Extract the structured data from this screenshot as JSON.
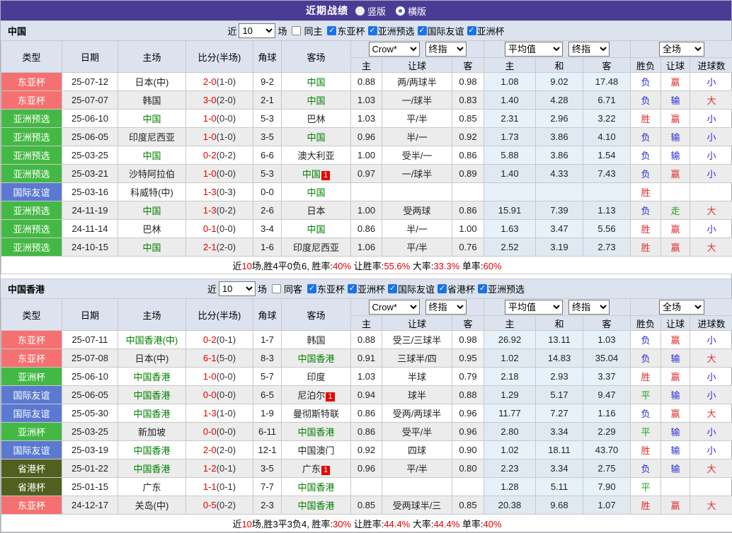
{
  "top_bar": {
    "title": "近期战绩",
    "radios": [
      {
        "label": "竖版",
        "selected": false
      },
      {
        "label": "横版",
        "selected": true
      }
    ]
  },
  "table_header": {
    "main_columns": [
      "类型",
      "日期",
      "主场",
      "比分(半场)",
      "角球",
      "客场"
    ],
    "dropdowns": {
      "crow": "Crow*",
      "final_a": "终指",
      "avg": "平均值",
      "final_b": "终指",
      "full": "全场"
    },
    "sub_columns": [
      "主",
      "让球",
      "客",
      "主",
      "和",
      "客",
      "胜负",
      "让球",
      "进球数"
    ]
  },
  "colors": {
    "topbar": "#4a3c94",
    "type_badges": {
      "东亚杯": "#f57070",
      "亚洲预选": "#44b844",
      "亚洲杯": "#44b844",
      "国际友谊": "#5b79d0",
      "省港杯": "#52601f"
    },
    "team_green": "#008000",
    "score_red": "#dd0000",
    "result_red": "#e03030",
    "result_blue": "#2b2bd5",
    "result_green": "#1f9e1f"
  },
  "sections": [
    {
      "team": "中国",
      "filters": {
        "near": "近",
        "count": "10",
        "games": "场",
        "same": "同主",
        "same_checked": false,
        "leagues": [
          "东亚杯",
          "亚洲预选",
          "国际友谊",
          "亚洲杯"
        ]
      },
      "rows": [
        {
          "type": "东亚杯",
          "date": "25-07-12",
          "home": "日本(中)",
          "home_green": false,
          "home_badge": "",
          "score": "2-0",
          "half": "(1-0)",
          "corner": "9-2",
          "away": "中国",
          "away_green": true,
          "away_badge": "",
          "odds": [
            "0.88",
            "两/两球半",
            "0.98"
          ],
          "avg": [
            "1.08",
            "9.02",
            "17.48"
          ],
          "res": [
            [
              "负",
              "b"
            ],
            [
              "赢",
              "r"
            ],
            [
              "小",
              "b"
            ]
          ]
        },
        {
          "type": "东亚杯",
          "date": "25-07-07",
          "home": "韩国",
          "home_green": false,
          "home_badge": "",
          "score": "3-0",
          "half": "(2-0)",
          "corner": "2-1",
          "away": "中国",
          "away_green": true,
          "away_badge": "",
          "odds": [
            "1.03",
            "一/球半",
            "0.83"
          ],
          "avg": [
            "1.40",
            "4.28",
            "6.71"
          ],
          "res": [
            [
              "负",
              "b"
            ],
            [
              "输",
              "b"
            ],
            [
              "大",
              "r"
            ]
          ]
        },
        {
          "type": "亚洲预选",
          "date": "25-06-10",
          "home": "中国",
          "home_green": true,
          "home_badge": "",
          "score": "1-0",
          "half": "(0-0)",
          "corner": "5-3",
          "away": "巴林",
          "away_green": false,
          "away_badge": "",
          "odds": [
            "1.03",
            "平/半",
            "0.85"
          ],
          "avg": [
            "2.31",
            "2.96",
            "3.22"
          ],
          "res": [
            [
              "胜",
              "r"
            ],
            [
              "赢",
              "r"
            ],
            [
              "小",
              "b"
            ]
          ]
        },
        {
          "type": "亚洲预选",
          "date": "25-06-05",
          "home": "印度尼西亚",
          "home_green": false,
          "home_badge": "",
          "score": "1-0",
          "half": "(1-0)",
          "corner": "3-5",
          "away": "中国",
          "away_green": true,
          "away_badge": "",
          "odds": [
            "0.96",
            "半/一",
            "0.92"
          ],
          "avg": [
            "1.73",
            "3.86",
            "4.10"
          ],
          "res": [
            [
              "负",
              "b"
            ],
            [
              "输",
              "b"
            ],
            [
              "小",
              "b"
            ]
          ]
        },
        {
          "type": "亚洲预选",
          "date": "25-03-25",
          "home": "中国",
          "home_green": true,
          "home_badge": "",
          "score": "0-2",
          "half": "(0-2)",
          "corner": "6-6",
          "away": "澳大利亚",
          "away_green": false,
          "away_badge": "",
          "odds": [
            "1.00",
            "受半/一",
            "0.86"
          ],
          "avg": [
            "5.88",
            "3.86",
            "1.54"
          ],
          "res": [
            [
              "负",
              "b"
            ],
            [
              "输",
              "b"
            ],
            [
              "小",
              "b"
            ]
          ]
        },
        {
          "type": "亚洲预选",
          "date": "25-03-21",
          "home": "沙特阿拉伯",
          "home_green": false,
          "home_badge": "",
          "score": "1-0",
          "half": "(0-0)",
          "corner": "5-3",
          "away": "中国",
          "away_green": true,
          "away_badge": "1",
          "odds": [
            "0.97",
            "一/球半",
            "0.89"
          ],
          "avg": [
            "1.40",
            "4.33",
            "7.43"
          ],
          "res": [
            [
              "负",
              "b"
            ],
            [
              "赢",
              "r"
            ],
            [
              "小",
              "b"
            ]
          ]
        },
        {
          "type": "国际友谊",
          "date": "25-03-16",
          "home": "科威特(中)",
          "home_green": false,
          "home_badge": "",
          "score": "1-3",
          "half": "(0-3)",
          "corner": "0-0",
          "away": "中国",
          "away_green": true,
          "away_badge": "",
          "odds": [
            "",
            "",
            ""
          ],
          "avg": [
            "",
            "",
            ""
          ],
          "res": [
            [
              "胜",
              "r"
            ],
            [
              "",
              ""
            ],
            [
              "",
              ""
            ]
          ]
        },
        {
          "type": "亚洲预选",
          "date": "24-11-19",
          "home": "中国",
          "home_green": true,
          "home_badge": "",
          "score": "1-3",
          "half": "(0-2)",
          "corner": "2-6",
          "away": "日本",
          "away_green": false,
          "away_badge": "",
          "odds": [
            "1.00",
            "受两球",
            "0.86"
          ],
          "avg": [
            "15.91",
            "7.39",
            "1.13"
          ],
          "res": [
            [
              "负",
              "b"
            ],
            [
              "走",
              "g"
            ],
            [
              "大",
              "r"
            ]
          ]
        },
        {
          "type": "亚洲预选",
          "date": "24-11-14",
          "home": "巴林",
          "home_green": false,
          "home_badge": "",
          "score": "0-1",
          "half": "(0-0)",
          "corner": "3-4",
          "away": "中国",
          "away_green": true,
          "away_badge": "",
          "odds": [
            "0.86",
            "半/一",
            "1.00"
          ],
          "avg": [
            "1.63",
            "3.47",
            "5.56"
          ],
          "res": [
            [
              "胜",
              "r"
            ],
            [
              "赢",
              "r"
            ],
            [
              "小",
              "b"
            ]
          ]
        },
        {
          "type": "亚洲预选",
          "date": "24-10-15",
          "home": "中国",
          "home_green": true,
          "home_badge": "",
          "score": "2-1",
          "half": "(2-0)",
          "corner": "1-6",
          "away": "印度尼西亚",
          "away_green": false,
          "away_badge": "",
          "odds": [
            "1.06",
            "平/半",
            "0.76"
          ],
          "avg": [
            "2.52",
            "3.19",
            "2.73"
          ],
          "res": [
            [
              "胜",
              "r"
            ],
            [
              "赢",
              "r"
            ],
            [
              "大",
              "r"
            ]
          ]
        }
      ],
      "summary": [
        [
          "近",
          0
        ],
        [
          "10",
          1
        ],
        [
          "场,胜4平0负6, 胜率:",
          0
        ],
        [
          "40%",
          1
        ],
        [
          " 让胜率:",
          0
        ],
        [
          "55.6%",
          1
        ],
        [
          " 大率:",
          0
        ],
        [
          "33.3%",
          1
        ],
        [
          " 单率:",
          0
        ],
        [
          "60%",
          1
        ]
      ]
    },
    {
      "team": "中国香港",
      "filters": {
        "near": "近",
        "count": "10",
        "games": "场",
        "same": "同客",
        "same_checked": false,
        "leagues": [
          "东亚杯",
          "亚洲杯",
          "国际友谊",
          "省港杯",
          "亚洲预选"
        ]
      },
      "rows": [
        {
          "type": "东亚杯",
          "date": "25-07-11",
          "home": "中国香港(中)",
          "home_green": true,
          "home_badge": "",
          "score": "0-2",
          "half": "(0-1)",
          "corner": "1-7",
          "away": "韩国",
          "away_green": false,
          "away_badge": "",
          "odds": [
            "0.88",
            "受三/三球半",
            "0.98"
          ],
          "avg": [
            "26.92",
            "13.11",
            "1.03"
          ],
          "res": [
            [
              "负",
              "b"
            ],
            [
              "赢",
              "r"
            ],
            [
              "小",
              "b"
            ]
          ]
        },
        {
          "type": "东亚杯",
          "date": "25-07-08",
          "home": "日本(中)",
          "home_green": false,
          "home_badge": "",
          "score": "6-1",
          "half": "(5-0)",
          "corner": "8-3",
          "away": "中国香港",
          "away_green": true,
          "away_badge": "",
          "odds": [
            "0.91",
            "三球半/四",
            "0.95"
          ],
          "avg": [
            "1.02",
            "14.83",
            "35.04"
          ],
          "res": [
            [
              "负",
              "b"
            ],
            [
              "输",
              "b"
            ],
            [
              "大",
              "r"
            ]
          ]
        },
        {
          "type": "亚洲杯",
          "date": "25-06-10",
          "home": "中国香港",
          "home_green": true,
          "home_badge": "",
          "score": "1-0",
          "half": "(0-0)",
          "corner": "5-7",
          "away": "印度",
          "away_green": false,
          "away_badge": "",
          "odds": [
            "1.03",
            "半球",
            "0.79"
          ],
          "avg": [
            "2.18",
            "2.93",
            "3.37"
          ],
          "res": [
            [
              "胜",
              "r"
            ],
            [
              "赢",
              "r"
            ],
            [
              "小",
              "b"
            ]
          ]
        },
        {
          "type": "国际友谊",
          "date": "25-06-05",
          "home": "中国香港",
          "home_green": true,
          "home_badge": "",
          "score": "0-0",
          "half": "(0-0)",
          "corner": "6-5",
          "away": "尼泊尔",
          "away_green": false,
          "away_badge": "1",
          "odds": [
            "0.94",
            "球半",
            "0.88"
          ],
          "avg": [
            "1.29",
            "5.17",
            "9.47"
          ],
          "res": [
            [
              "平",
              "g"
            ],
            [
              "输",
              "b"
            ],
            [
              "小",
              "b"
            ]
          ]
        },
        {
          "type": "国际友谊",
          "date": "25-05-30",
          "home": "中国香港",
          "home_green": true,
          "home_badge": "",
          "score": "1-3",
          "half": "(1-0)",
          "corner": "1-9",
          "away": "曼彻斯特联",
          "away_green": false,
          "away_badge": "",
          "odds": [
            "0.86",
            "受两/两球半",
            "0.96"
          ],
          "avg": [
            "11.77",
            "7.27",
            "1.16"
          ],
          "res": [
            [
              "负",
              "b"
            ],
            [
              "赢",
              "r"
            ],
            [
              "大",
              "r"
            ]
          ]
        },
        {
          "type": "亚洲杯",
          "date": "25-03-25",
          "home": "新加坡",
          "home_green": false,
          "home_badge": "",
          "score": "0-0",
          "half": "(0-0)",
          "corner": "6-11",
          "away": "中国香港",
          "away_green": true,
          "away_badge": "",
          "odds": [
            "0.86",
            "受平/半",
            "0.96"
          ],
          "avg": [
            "2.80",
            "3.34",
            "2.29"
          ],
          "res": [
            [
              "平",
              "g"
            ],
            [
              "输",
              "b"
            ],
            [
              "小",
              "b"
            ]
          ]
        },
        {
          "type": "国际友谊",
          "date": "25-03-19",
          "home": "中国香港",
          "home_green": true,
          "home_badge": "",
          "score": "2-0",
          "half": "(2-0)",
          "corner": "12-1",
          "away": "中国澳门",
          "away_green": false,
          "away_badge": "",
          "odds": [
            "0.92",
            "四球",
            "0.90"
          ],
          "avg": [
            "1.02",
            "18.11",
            "43.70"
          ],
          "res": [
            [
              "胜",
              "r"
            ],
            [
              "输",
              "b"
            ],
            [
              "小",
              "b"
            ]
          ]
        },
        {
          "type": "省港杯",
          "date": "25-01-22",
          "home": "中国香港",
          "home_green": true,
          "home_badge": "",
          "score": "1-2",
          "half": "(0-1)",
          "corner": "3-5",
          "away": "广东",
          "away_green": false,
          "away_badge": "1",
          "odds": [
            "0.96",
            "平/半",
            "0.80"
          ],
          "avg": [
            "2.23",
            "3.34",
            "2.75"
          ],
          "res": [
            [
              "负",
              "b"
            ],
            [
              "输",
              "b"
            ],
            [
              "大",
              "r"
            ]
          ]
        },
        {
          "type": "省港杯",
          "date": "25-01-15",
          "home": "广东",
          "home_green": false,
          "home_badge": "",
          "score": "1-1",
          "half": "(0-1)",
          "corner": "7-7",
          "away": "中国香港",
          "away_green": true,
          "away_badge": "",
          "odds": [
            "",
            "",
            ""
          ],
          "avg": [
            "1.28",
            "5.11",
            "7.90"
          ],
          "res": [
            [
              "平",
              "g"
            ],
            [
              "",
              ""
            ],
            [
              "",
              ""
            ]
          ]
        },
        {
          "type": "东亚杯",
          "date": "24-12-17",
          "home": "关岛(中)",
          "home_green": false,
          "home_badge": "",
          "score": "0-5",
          "half": "(0-2)",
          "corner": "2-3",
          "away": "中国香港",
          "away_green": true,
          "away_badge": "",
          "odds": [
            "0.85",
            "受两球半/三",
            "0.85"
          ],
          "avg": [
            "20.38",
            "9.68",
            "1.07"
          ],
          "res": [
            [
              "胜",
              "r"
            ],
            [
              "赢",
              "r"
            ],
            [
              "大",
              "r"
            ]
          ]
        }
      ],
      "summary": [
        [
          "近",
          0
        ],
        [
          "10",
          1
        ],
        [
          "场,胜3平3负4, 胜率:",
          0
        ],
        [
          "30%",
          1
        ],
        [
          " 让胜率:",
          0
        ],
        [
          "44.4%",
          1
        ],
        [
          " 大率:",
          0
        ],
        [
          "44.4%",
          1
        ],
        [
          " 单率:",
          0
        ],
        [
          "40%",
          1
        ]
      ]
    }
  ]
}
